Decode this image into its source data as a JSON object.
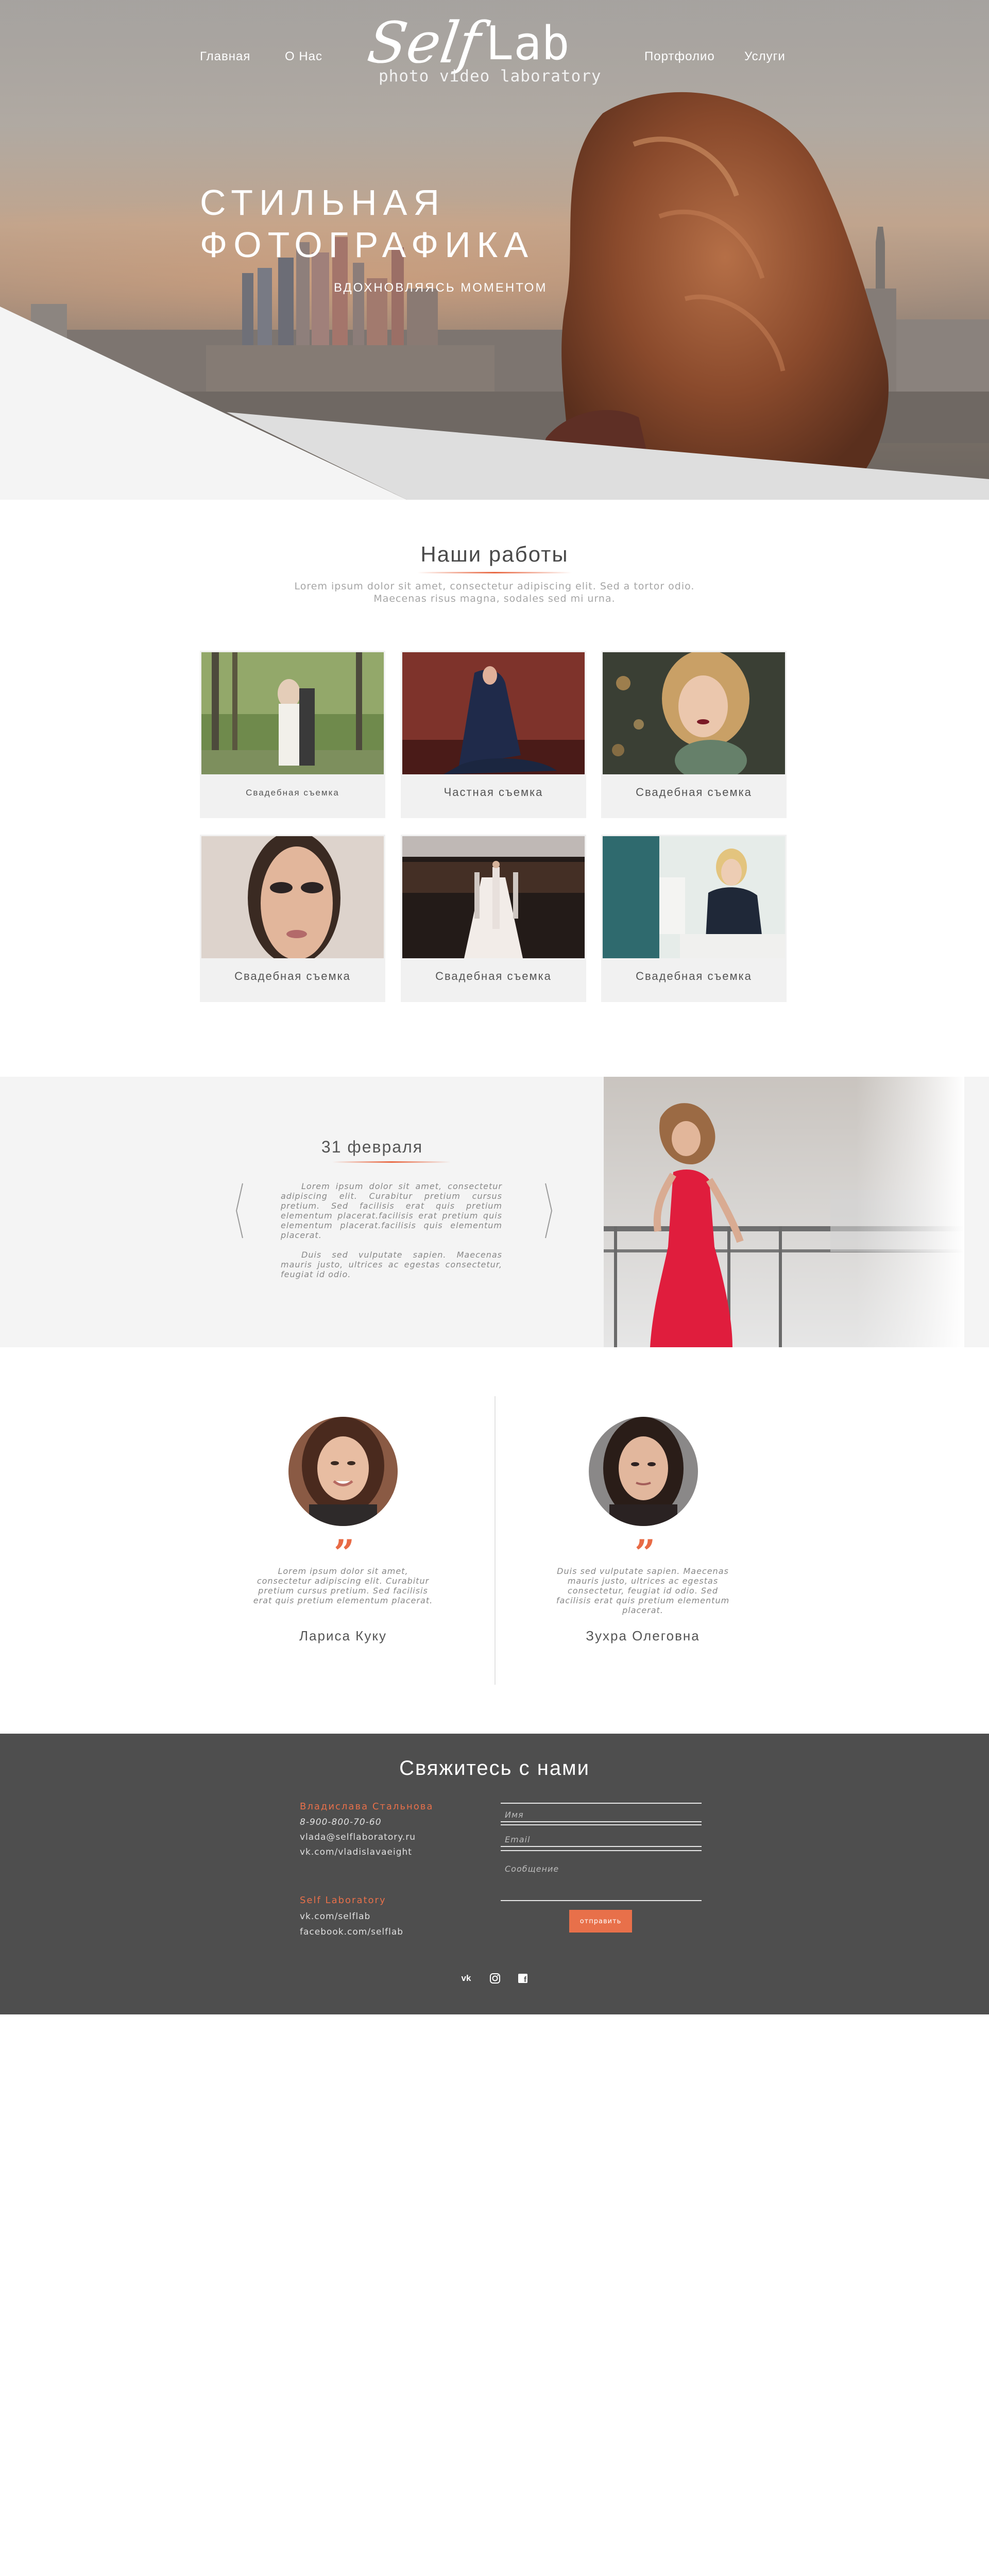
{
  "nav": {
    "home": "Главная",
    "about": "О Нас",
    "portfolio": "Портфолио",
    "services": "Услуги"
  },
  "logo": {
    "self": "Self",
    "lab": "Lab",
    "tagline": "photo video laboratory"
  },
  "hero": {
    "title_line1": "СТИЛЬНАЯ",
    "title_line2": "ФОТОГРАФИКА",
    "subtitle": "ВДОХНОВЛЯЯСЬ МОМЕНТОМ"
  },
  "works": {
    "title": "Наши работы",
    "intro_line1": "Lorem ipsum dolor sit amet, consectetur adipiscing elit. Sed a tortor odio.",
    "intro_line2": "Maecenas risus magna, sodales sed mi urna.",
    "cards": [
      {
        "caption": "Свадебная съемка"
      },
      {
        "caption": "Частная съемка"
      },
      {
        "caption": "Свадебная съемка"
      },
      {
        "caption": "Свадебная съемка"
      },
      {
        "caption": "Свадебная съемка"
      },
      {
        "caption": "Свадебная съемка"
      }
    ]
  },
  "event": {
    "date": "31 февраля",
    "paragraph1": "Lorem ipsum dolor sit amet, consectetur adipiscing elit. Curabitur pretium cursus pretium. Sed facilisis erat quis pretium elementum placerat.facilisis erat pretium quis elementum placerat.facilisis quis elementum placerat.",
    "paragraph2": "Duis sed vulputate sapien. Maecenas mauris justo, ultrices ac egestas consectetur, feugiat id odio."
  },
  "testimonials": [
    {
      "text": "Lorem ipsum dolor sit amet, consectetur adipiscing elit. Curabitur pretium cursus pretium. Sed facilisis erat quis pretium elementum placerat.",
      "name": "Лариса Куку"
    },
    {
      "text": "Duis sed vulputate sapien. Maecenas mauris justo, ultrices ac egestas consectetur, feugiat id odio. Sed facilisis erat quis pretium elementum placerat.",
      "name": "Зухра Олеговна"
    }
  ],
  "contact": {
    "title": "Свяжитесь с нами",
    "person_name": "Владислава Стальнова",
    "phone": "8-900-800-70-60",
    "email": "vlada@selflaboratory.ru",
    "vk_personal": "vk.com/vladislavaeight",
    "company": "Self Laboratory",
    "vk_company": "vk.com/selflab",
    "fb_company": "facebook.com/selflab",
    "form": {
      "name_placeholder": "Имя",
      "email_placeholder": "Email",
      "message_placeholder": "Сообщение",
      "send_label": "отправить"
    },
    "social": {
      "vk": "vk",
      "instagram": "instagram-icon",
      "facebook": "f"
    }
  },
  "colors": {
    "accent": "#e8704a",
    "footer_bg": "#4e4e4e",
    "light_bg": "#f4f4f4"
  }
}
